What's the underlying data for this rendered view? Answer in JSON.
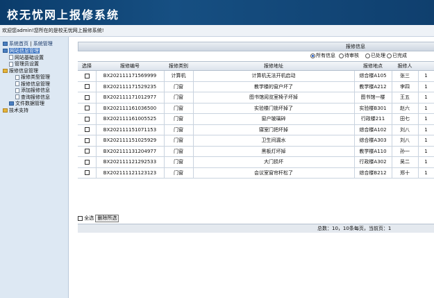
{
  "header": {
    "title": "校无忧网上报修系统"
  },
  "welcome": {
    "text": "欢迎您admin!您所在的是校无忧网上报修系统!"
  },
  "sidebar": {
    "links": [
      "系统首页",
      "系统管理"
    ],
    "tree": [
      {
        "label": "网站信息管理",
        "level": 0,
        "icon": "root-icon",
        "selected": true
      },
      {
        "label": "网站基础设置",
        "level": 1,
        "icon": "doc-icon",
        "selected": false
      },
      {
        "label": "管理员设置",
        "level": 1,
        "icon": "doc-icon",
        "selected": false
      },
      {
        "label": "报修信息管理",
        "level": 0,
        "icon": "folder-icon",
        "selected": false
      },
      {
        "label": "报修类型管理",
        "level": 2,
        "icon": "doc-icon",
        "selected": false
      },
      {
        "label": "报修信息管理",
        "level": 2,
        "icon": "doc-icon",
        "selected": false
      },
      {
        "label": "添加报修信息",
        "level": 2,
        "icon": "doc-icon",
        "selected": false
      },
      {
        "label": "查询报修信息",
        "level": 2,
        "icon": "doc-icon",
        "selected": false
      },
      {
        "label": "文件数据管理",
        "level": 1,
        "icon": "root-icon",
        "selected": false
      },
      {
        "label": "技术支持",
        "level": 0,
        "icon": "folder-icon",
        "selected": false
      }
    ]
  },
  "panel": {
    "title": "报修信息"
  },
  "filters": [
    {
      "label": "所有信息",
      "checked": true
    },
    {
      "label": "待审核",
      "checked": false
    },
    {
      "label": "已处理",
      "checked": false
    },
    {
      "label": "已完成",
      "checked": false
    }
  ],
  "table": {
    "columns": [
      "选择",
      "报修编号",
      "报修类别",
      "报修地址",
      "报修地点",
      "报修人",
      ""
    ],
    "rows": [
      [
        "BX202111171569999",
        "计算机",
        "计算机无法开机启动",
        "综合楼A105",
        "张三",
        "1"
      ],
      [
        "BX202111171529235",
        "门窗",
        "教学楼的窗户坏了",
        "教学楼A212",
        "李四",
        "1"
      ],
      [
        "BX202111171012977",
        "门窗",
        "图书馆阅览室椅子坏掉",
        "图书馆一楼",
        "王五",
        "1"
      ],
      [
        "BX202111161036500",
        "门窗",
        "实验楼门锁坏掉了",
        "实验楼B301",
        "赵六",
        "1"
      ],
      [
        "BX202111161005525",
        "门窗",
        "窗户玻璃碎",
        "行政楼211",
        "田七",
        "1"
      ],
      [
        "BX202111151071153",
        "门窗",
        "寝室门把坏掉",
        "综合楼A102",
        "刘八",
        "1"
      ],
      [
        "BX202111151025929",
        "门窗",
        "卫生间漏水",
        "综合楼A303",
        "刘八",
        "1"
      ],
      [
        "BX202111131204977",
        "门窗",
        "黑板灯坏掉",
        "教学楼A110",
        "孙一",
        "1"
      ],
      [
        "BX202111121292533",
        "门窗",
        "大门损坏",
        "行政楼A302",
        "吴二",
        "1"
      ],
      [
        "BX202111121123123",
        "门窗",
        "会议室窗帘杆松了",
        "综合楼B212",
        "郑十",
        "1"
      ]
    ]
  },
  "bottom": {
    "select_all": "全选",
    "delete_label": "删除所选"
  },
  "pager": {
    "text": "总数：10，10条每页，当前页：1"
  }
}
